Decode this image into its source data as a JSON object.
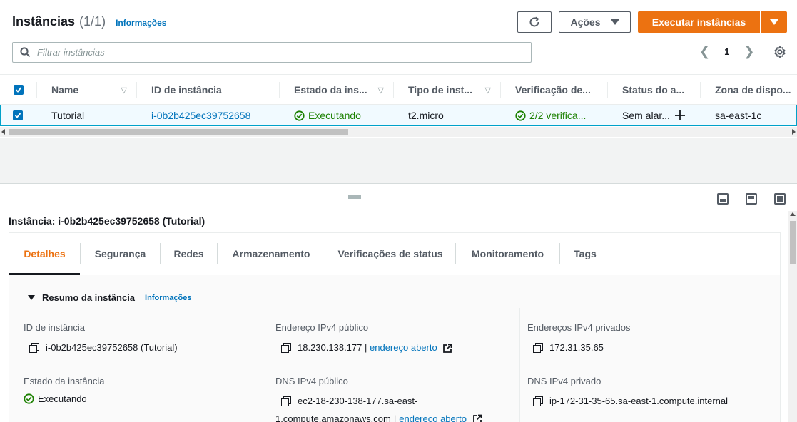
{
  "header": {
    "title": "Instâncias",
    "count": "(1/1)",
    "info_link": "Informações"
  },
  "toolbar": {
    "refresh_icon": "refresh-icon",
    "actions_label": "Ações",
    "launch_label": "Executar instâncias"
  },
  "search": {
    "placeholder": "Filtrar instâncias"
  },
  "pagination": {
    "current_page": "1"
  },
  "table": {
    "columns": [
      "Name",
      "ID de instância",
      "Estado da ins...",
      "Tipo de inst...",
      "Verificação de...",
      "Status do a...",
      "Zona de dispo..."
    ],
    "rows": [
      {
        "name": "Tutorial",
        "instance_id": "i-0b2b425ec39752658",
        "state": "Executando",
        "type": "t2.micro",
        "checks": "2/2 verifica...",
        "alarm_status": "Sem alar...",
        "zone": "sa-east-1c"
      }
    ]
  },
  "details": {
    "title": "Instância: i-0b2b425ec39752658 (Tutorial)",
    "tabs": [
      "Detalhes",
      "Segurança",
      "Redes",
      "Armazenamento",
      "Verificações de status",
      "Monitoramento",
      "Tags"
    ],
    "active_tab": "Detalhes",
    "summary": {
      "heading": "Resumo da instância",
      "info_link": "Informações",
      "instance_id_label": "ID de instância",
      "instance_id_value": "i-0b2b425ec39752658 (Tutorial)",
      "public_ipv4_label": "Endereço IPv4 público",
      "public_ipv4_value": "18.230.138.177",
      "open_address_label": "endereço aberto",
      "private_ipv4_label": "Endereços IPv4 privados",
      "private_ipv4_value": "172.31.35.65",
      "state_label": "Estado da instância",
      "state_value": "Executando",
      "public_dns_label": "DNS IPv4 público",
      "public_dns_line1": "ec2-18-230-138-177.sa-east-",
      "public_dns_line2": "1.compute.amazonaws.com",
      "private_dns_label": "DNS IPv4 privado",
      "private_dns_value": "ip-172-31-35-65.sa-east-1.compute.internal",
      "separator": "|"
    }
  },
  "colors": {
    "accent": "#ec7211",
    "link": "#0073bb",
    "success": "#1d8102"
  }
}
